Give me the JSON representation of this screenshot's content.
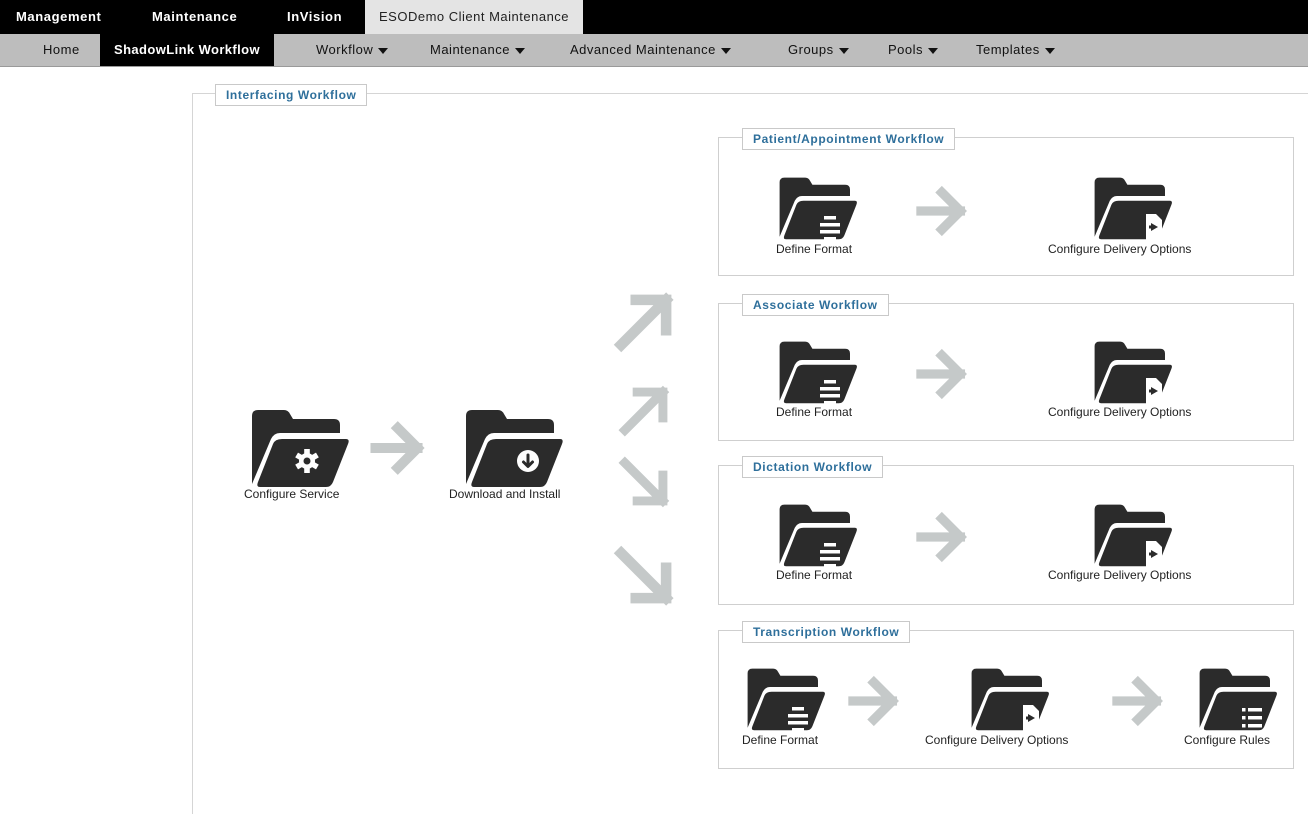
{
  "top_tabs": [
    "Management",
    "Maintenance",
    "InVision",
    "ESODemo Client Maintenance"
  ],
  "sub_tabs": {
    "home": "Home",
    "shadowlink": "ShadowLink Workflow",
    "workflow": "Workflow",
    "maintenance": "Maintenance",
    "advanced": "Advanced Maintenance",
    "groups": "Groups",
    "pools": "Pools",
    "templates": "Templates"
  },
  "interfacing": {
    "title": "Interfacing Workflow",
    "configure_service": "Configure Service",
    "download_install": "Download and Install"
  },
  "patient": {
    "title": "Patient/Appointment Workflow",
    "define": "Define Format",
    "delivery": "Configure Delivery Options"
  },
  "associate": {
    "title": "Associate Workflow",
    "define": "Define Format",
    "delivery": "Configure Delivery Options"
  },
  "dictation": {
    "title": "Dictation Workflow",
    "define": "Define Format",
    "delivery": "Configure Delivery Options"
  },
  "transcription": {
    "title": "Transcription Workflow",
    "define": "Define Format",
    "delivery": "Configure Delivery Options",
    "rules": "Configure Rules"
  },
  "colors": {
    "icon": "#2b2b2b",
    "arrow": "#c5c9c9",
    "legend_text": "#2e6f9b",
    "topbar": "#000000",
    "subbar": "#bdbdbd"
  },
  "icons": [
    "folder-gear-icon",
    "folder-download-icon",
    "folder-format-icon",
    "folder-delivery-icon",
    "folder-rules-icon",
    "arrow-right-icon",
    "arrow-up-right-icon",
    "arrow-down-right-icon"
  ]
}
